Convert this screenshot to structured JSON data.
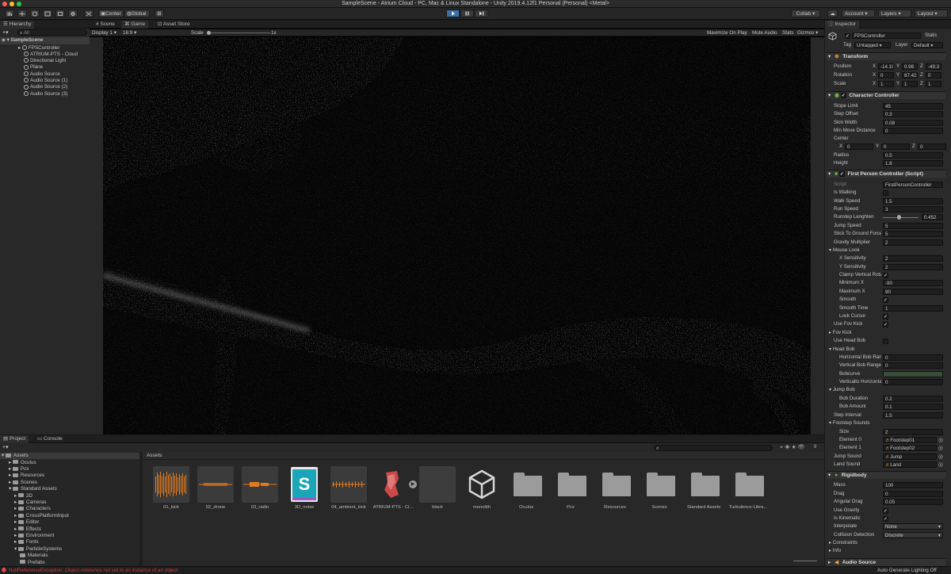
{
  "window": {
    "title": "SampleScene - Atrium Cloud - PC, Mac & Linux Standalone - Unity 2019.4.12f1 Personal (Personal) <Metal>"
  },
  "toolbar": {
    "center": "Center",
    "global": "Global",
    "collab": "Collab",
    "account": "Account",
    "layers": "Layers",
    "layout": "Layout"
  },
  "hierarchy": {
    "tab": "Hierarchy",
    "search_placeholder": "All",
    "scene": "SampleScene",
    "items": [
      "FPSController",
      "ATRIUM-PTS - Cloud",
      "Directional Light",
      "Plane",
      "Audio Source",
      "Audio Source (1)",
      "Audio Source (2)",
      "Audio Source (3)"
    ]
  },
  "scene_tabs": {
    "scene": "Scene",
    "game": "Game",
    "asset_store": "Asset Store"
  },
  "game": {
    "display": "Display 1",
    "aspect": "16:9",
    "scale_label": "Scale",
    "scale_value": "1x",
    "maximize": "Maximize On Play",
    "mute": "Mute Audio",
    "stats": "Stats",
    "gizmos": "Gizmos"
  },
  "inspector": {
    "tab": "Inspector",
    "object_name": "FPSController",
    "static": "Static",
    "tag_label": "Tag",
    "tag_value": "Untagged",
    "layer_label": "Layer",
    "layer_value": "Default",
    "transform": {
      "title": "Transform",
      "position_label": "Position",
      "rotation_label": "Rotation",
      "scale_label": "Scale",
      "position": [
        "-14.19",
        "0.98",
        "-49.3"
      ],
      "rotation": [
        "0",
        "87.425",
        "0"
      ],
      "scale": [
        "1",
        "1",
        "1"
      ]
    },
    "cc": {
      "title": "Character Controller",
      "rows": [
        {
          "label": "Slope Limit",
          "value": "45"
        },
        {
          "label": "Step Offset",
          "value": "0.3"
        },
        {
          "label": "Skin Width",
          "value": "0.08"
        },
        {
          "label": "Min Move Distance",
          "value": "0"
        }
      ],
      "center_label": "Center",
      "center": [
        "0",
        "0",
        "0"
      ],
      "radius_label": "Radius",
      "radius": "0.5",
      "height_label": "Height",
      "height": "1.8"
    },
    "fpc": {
      "title": "First Person Controller (Script)",
      "script_label": "Script",
      "script_value": "FirstPersonController",
      "is_walking": "Is Walking",
      "walk_speed_label": "Walk Speed",
      "walk_speed": "1.5",
      "run_speed_label": "Run Speed",
      "run_speed": "3",
      "runstep_label": "Runstep Lenghten",
      "runstep": "0.452",
      "runstep_fraction": 0.45,
      "jump_speed_label": "Jump Speed",
      "jump_speed": "5",
      "stick_label": "Stick To Ground Force",
      "stick": "5",
      "gravity_label": "Gravity Multiplier",
      "gravity": "2",
      "mouse_look": "Mouse Look",
      "xsens_label": "X Sensitivity",
      "xsens": "2",
      "ysens_label": "Y Sensitivity",
      "ysens": "2",
      "clamp_label": "Clamp Vertical Rotation",
      "minx_label": "Minimum X",
      "minx": "-90",
      "maxx_label": "Maximum X",
      "maxx": "90",
      "smooth_label": "Smooth",
      "smoothtime_label": "Smooth Time",
      "smoothtime": "1",
      "lockcursor_label": "Lock Cursor",
      "usefov_label": "Use Fov Kick",
      "fovkick_label": "Fov Kick",
      "useheadbob_label": "Use Head Bob",
      "headbob_label": "Head Bob",
      "hbob_label": "Horizontal Bob Range",
      "hbob": "0",
      "vbob_label": "Vertical Bob Range",
      "vbob": "0",
      "bobcurve_label": "Bobcurve",
      "vthoriz_label": "Verticalto Horizontal",
      "vthoriz": "0",
      "jumpbob_label": "Jump Bob",
      "bobdur_label": "Bob Duration",
      "bobdur": "0.2",
      "bobamt_label": "Bob Amount",
      "bobamt": "0.1",
      "stepint_label": "Step Interval",
      "stepint": "1.5",
      "footsteps_label": "Footstep Sounds",
      "size_label": "Size",
      "size": "2",
      "el0_label": "Element 0",
      "el0": "Footstep01",
      "el1_label": "Element 1",
      "el1": "Footstep02",
      "jumpsound_label": "Jump Sound",
      "jumpsound": "Jump",
      "landsound_label": "Land Sound",
      "landsound": "Land"
    },
    "rb": {
      "title": "Rigidbody",
      "mass_label": "Mass",
      "mass": "100",
      "drag_label": "Drag",
      "drag": "0",
      "adrag_label": "Angular Drag",
      "adrag": "0.05",
      "usegrav_label": "Use Gravity",
      "kinematic_label": "Is Kinematic",
      "interp_label": "Interpolate",
      "interp": "None",
      "coll_label": "Collision Detection",
      "coll": "Discrete",
      "constraints_label": "Constraints",
      "info_label": "Info"
    },
    "audio": {
      "title": "Audio Source"
    }
  },
  "project": {
    "tab_project": "Project",
    "tab_console": "Console",
    "tree_root": "Assets",
    "tree": [
      "Oculus",
      "Pcx",
      "Resources",
      "Scenes",
      "Standard Assets",
      "2D",
      "Cameras",
      "Characters",
      "CrossPlatformInput",
      "Editor",
      "Effects",
      "Environment",
      "Fonts",
      "ParticleSystems",
      "Materials",
      "Prefabs"
    ],
    "breadcrumb": "Assets",
    "assets": [
      "01_kick",
      "02_drone",
      "03_radio",
      "3D_noise",
      "04_ambient_kick",
      "ATRIUM-PTS - Cl...",
      "black",
      "monolith",
      "Oculus",
      "Pcx",
      "Resources",
      "Scenes",
      "Standard Assets",
      "Turbulence-Libra..."
    ],
    "hidden_count": "9"
  },
  "status": {
    "error": "NullReferenceException: Object reference not set to an instance of an object",
    "lighting": "Auto Generate Lighting Off"
  },
  "colors": {
    "accent": "#3a72b0",
    "error": "#d03a3a",
    "audio_wave": "#e07a1e"
  }
}
